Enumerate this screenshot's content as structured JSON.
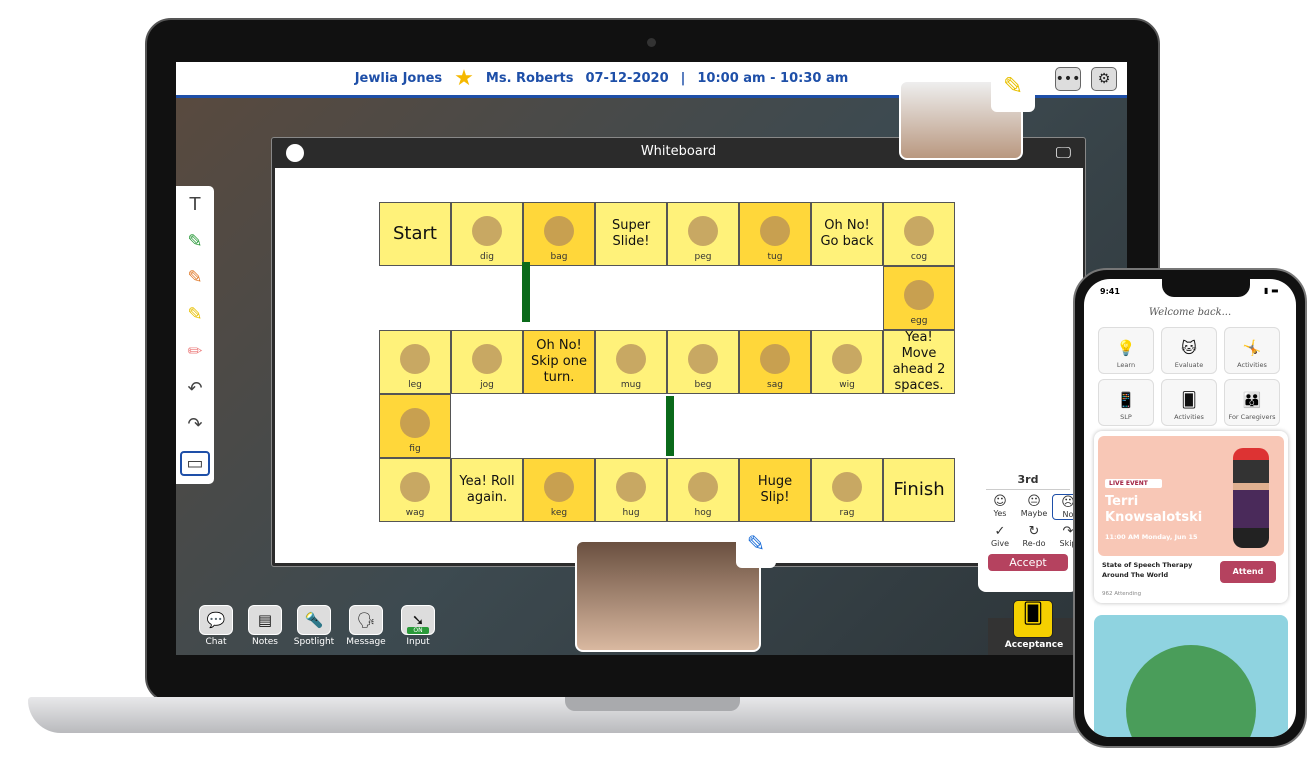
{
  "header": {
    "student": "Jewlia Jones",
    "teacher": "Ms. Roberts",
    "date": "07-12-2020",
    "separator": "|",
    "time": "10:00 am - 10:30 am",
    "more_icon": "ellipsis-icon",
    "settings_icon": "gear-icon"
  },
  "whiteboard": {
    "title": "Whiteboard"
  },
  "board": {
    "cells": [
      {
        "label": "Start",
        "type": "text",
        "shade": "l"
      },
      {
        "label": "dig",
        "shade": "l"
      },
      {
        "label": "bag",
        "shade": "d"
      },
      {
        "label": "Super Slide!",
        "type": "text",
        "shade": "l"
      },
      {
        "label": "peg",
        "shade": "l"
      },
      {
        "label": "tug",
        "shade": "d"
      },
      {
        "label": "Oh No! Go back",
        "type": "text",
        "shade": "l"
      },
      {
        "label": "cog",
        "shade": "l"
      },
      {
        "label": "egg",
        "shade": "d"
      },
      {
        "label": "leg",
        "shade": "l"
      },
      {
        "label": "jog",
        "shade": "l"
      },
      {
        "label": "Oh No! Skip one turn.",
        "type": "text",
        "shade": "d"
      },
      {
        "label": "mug",
        "shade": "l"
      },
      {
        "label": "beg",
        "shade": "l"
      },
      {
        "label": "sag",
        "shade": "d"
      },
      {
        "label": "wig",
        "shade": "l"
      },
      {
        "label": "Yea! Move ahead 2 spaces.",
        "type": "text",
        "shade": "l"
      },
      {
        "label": "fig",
        "shade": "d"
      },
      {
        "label": "wag",
        "shade": "l"
      },
      {
        "label": "Yea! Roll again.",
        "type": "text",
        "shade": "l"
      },
      {
        "label": "keg",
        "shade": "d"
      },
      {
        "label": "hug",
        "shade": "l"
      },
      {
        "label": "hog",
        "shade": "l"
      },
      {
        "label": "Huge Slip!",
        "type": "text",
        "shade": "d"
      },
      {
        "label": "rag",
        "shade": "l"
      },
      {
        "label": "Finish",
        "type": "text",
        "shade": "l"
      }
    ]
  },
  "toolbar": [
    {
      "label": "Chat",
      "icon": "chat-icon"
    },
    {
      "label": "Notes",
      "icon": "clipboard-icon"
    },
    {
      "label": "Spotlight",
      "icon": "flashlight-icon"
    },
    {
      "label": "Message",
      "icon": "speaker-person-icon"
    },
    {
      "label": "Input",
      "icon": "cursor-icon",
      "badge": "ON"
    }
  ],
  "acceptance": {
    "title": "3rd",
    "options": [
      "Yes",
      "Maybe",
      "No",
      "Give",
      "Re-do",
      "Skip"
    ],
    "accept": "Accept",
    "button": "Acceptance"
  },
  "phone": {
    "time": "9:41",
    "welcome": "Welcome back...",
    "tiles": [
      "Learn",
      "Evaluate",
      "Activities",
      "SLP",
      "Activities",
      "For Caregivers"
    ],
    "event": {
      "badge": "LIVE EVENT",
      "name_line1": "Terri",
      "name_line2": "Knowsalotski",
      "when": "11:00 AM Monday, Jun 15",
      "title": "State of Speech Therapy Around The World",
      "attending": "962 Attending",
      "attend": "Attend"
    }
  },
  "colors": {
    "accent": "#1e4fa8",
    "accept": "#b5425f",
    "cell_light": "#fff27a",
    "cell_dark": "#ffd73a",
    "arrow": "#0a6a1a"
  }
}
